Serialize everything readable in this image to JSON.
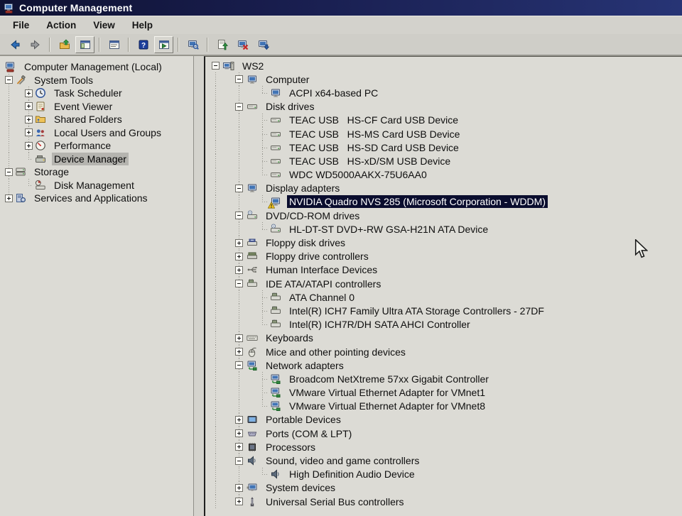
{
  "window": {
    "title": "Computer Management",
    "icon": "computer-management"
  },
  "menu": {
    "items": [
      "File",
      "Action",
      "View",
      "Help"
    ]
  },
  "toolbar": {
    "items": [
      {
        "name": "back-button",
        "icon": "back-arrow"
      },
      {
        "name": "forward-button",
        "icon": "forward-arrow"
      },
      {
        "separator": true
      },
      {
        "name": "up-one-level-button",
        "icon": "folder-up"
      },
      {
        "name": "show-console-tree-button",
        "icon": "window-tree",
        "pressed": true
      },
      {
        "separator": true
      },
      {
        "name": "properties-button",
        "icon": "window-properties"
      },
      {
        "separator": true
      },
      {
        "name": "help-button",
        "icon": "help-question"
      },
      {
        "name": "show-action-pane-button",
        "icon": "window-action",
        "pressed": true
      },
      {
        "separator": true
      },
      {
        "name": "scan-hardware-changes-button",
        "icon": "computer-search"
      },
      {
        "separator": true
      },
      {
        "name": "update-driver-button",
        "icon": "page-green-arrow"
      },
      {
        "name": "uninstall-device-button",
        "icon": "computer-red-x"
      },
      {
        "name": "disable-device-button",
        "icon": "computer-down-arrow"
      }
    ]
  },
  "left_tree": {
    "rows": [
      {
        "indent": 0,
        "expander": "",
        "icon": "console-root",
        "label": "Computer Management (Local)",
        "root": true
      },
      {
        "indent": 0,
        "expander": "-",
        "icon": "system-tools",
        "label": "System Tools"
      },
      {
        "indent": 1,
        "expander": "+",
        "icon": "task-scheduler",
        "label": "Task Scheduler"
      },
      {
        "indent": 1,
        "expander": "+",
        "icon": "event-viewer",
        "label": "Event Viewer"
      },
      {
        "indent": 1,
        "expander": "+",
        "icon": "shared-folders",
        "label": "Shared Folders"
      },
      {
        "indent": 1,
        "expander": "+",
        "icon": "local-users",
        "label": "Local Users and Groups"
      },
      {
        "indent": 1,
        "expander": "+",
        "icon": "performance",
        "label": "Performance"
      },
      {
        "indent": 1,
        "expander": "",
        "icon": "device-manager",
        "label": "Device Manager",
        "selected": "inactive"
      },
      {
        "indent": 0,
        "expander": "-",
        "icon": "storage",
        "label": "Storage"
      },
      {
        "indent": 1,
        "expander": "",
        "icon": "disk-management",
        "label": "Disk Management"
      },
      {
        "indent": 0,
        "expander": "+",
        "icon": "services-apps",
        "label": "Services and Applications"
      }
    ]
  },
  "right_tree": {
    "rows": [
      {
        "indent": 0,
        "expander": "-",
        "icon": "computer-ws",
        "label": "WS2"
      },
      {
        "indent": 1,
        "expander": "-",
        "icon": "monitor-device",
        "label": "Computer"
      },
      {
        "indent": 2,
        "expander": "",
        "icon": "monitor-device",
        "label": "ACPI x64-based PC"
      },
      {
        "indent": 1,
        "expander": "-",
        "icon": "disk-drive",
        "label": "Disk drives"
      },
      {
        "indent": 2,
        "expander": "",
        "icon": "disk-drive",
        "label": "TEAC USB   HS-CF Card USB Device"
      },
      {
        "indent": 2,
        "expander": "",
        "icon": "disk-drive",
        "label": "TEAC USB   HS-MS Card USB Device"
      },
      {
        "indent": 2,
        "expander": "",
        "icon": "disk-drive",
        "label": "TEAC USB   HS-SD Card USB Device"
      },
      {
        "indent": 2,
        "expander": "",
        "icon": "disk-drive",
        "label": "TEAC USB   HS-xD/SM USB Device"
      },
      {
        "indent": 2,
        "expander": "",
        "icon": "disk-drive",
        "label": "WDC WD5000AAKX-75U6AA0"
      },
      {
        "indent": 1,
        "expander": "-",
        "icon": "display-adapter",
        "label": "Display adapters"
      },
      {
        "indent": 2,
        "expander": "",
        "icon": "display-adapter",
        "label": "NVIDIA Quadro NVS 285 (Microsoft Corporation - WDDM)",
        "selected": "active",
        "warning": true
      },
      {
        "indent": 1,
        "expander": "-",
        "icon": "dvd-drive",
        "label": "DVD/CD-ROM drives"
      },
      {
        "indent": 2,
        "expander": "",
        "icon": "dvd-drive",
        "label": "HL-DT-ST DVD+-RW GSA-H21N ATA Device"
      },
      {
        "indent": 1,
        "expander": "+",
        "icon": "floppy-drive",
        "label": "Floppy disk drives"
      },
      {
        "indent": 1,
        "expander": "+",
        "icon": "floppy-controller",
        "label": "Floppy drive controllers"
      },
      {
        "indent": 1,
        "expander": "+",
        "icon": "hid-device",
        "label": "Human Interface Devices"
      },
      {
        "indent": 1,
        "expander": "-",
        "icon": "ide-controller",
        "label": "IDE ATA/ATAPI controllers"
      },
      {
        "indent": 2,
        "expander": "",
        "icon": "ide-controller",
        "label": "ATA Channel 0"
      },
      {
        "indent": 2,
        "expander": "",
        "icon": "ide-controller",
        "label": "Intel(R) ICH7 Family Ultra ATA Storage Controllers - 27DF"
      },
      {
        "indent": 2,
        "expander": "",
        "icon": "ide-controller",
        "label": "Intel(R) ICH7R/DH SATA AHCI Controller"
      },
      {
        "indent": 1,
        "expander": "+",
        "icon": "keyboard-device",
        "label": "Keyboards"
      },
      {
        "indent": 1,
        "expander": "+",
        "icon": "mouse-device",
        "label": "Mice and other pointing devices"
      },
      {
        "indent": 1,
        "expander": "-",
        "icon": "network-adapter",
        "label": "Network adapters"
      },
      {
        "indent": 2,
        "expander": "",
        "icon": "network-adapter",
        "label": "Broadcom NetXtreme 57xx Gigabit Controller"
      },
      {
        "indent": 2,
        "expander": "",
        "icon": "network-adapter",
        "label": "VMware Virtual Ethernet Adapter for VMnet1"
      },
      {
        "indent": 2,
        "expander": "",
        "icon": "network-adapter",
        "label": "VMware Virtual Ethernet Adapter for VMnet8"
      },
      {
        "indent": 1,
        "expander": "+",
        "icon": "portable-device",
        "label": "Portable Devices"
      },
      {
        "indent": 1,
        "expander": "+",
        "icon": "port-device",
        "label": "Ports (COM & LPT)"
      },
      {
        "indent": 1,
        "expander": "+",
        "icon": "processor-device",
        "label": "Processors"
      },
      {
        "indent": 1,
        "expander": "-",
        "icon": "sound-device",
        "label": "Sound, video and game controllers"
      },
      {
        "indent": 2,
        "expander": "",
        "icon": "sound-device",
        "label": "High Definition Audio Device"
      },
      {
        "indent": 1,
        "expander": "+",
        "icon": "system-device",
        "label": "System devices"
      },
      {
        "indent": 1,
        "expander": "+",
        "icon": "usb-controller",
        "label": "Universal Serial Bus controllers"
      }
    ]
  }
}
